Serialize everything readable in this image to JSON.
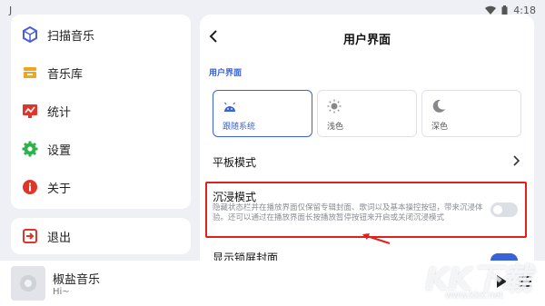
{
  "statusbar": {
    "left_glyph": "J",
    "time": "4:18"
  },
  "sidebar": {
    "items": [
      {
        "label": "扫描音乐",
        "icon": "cube-icon"
      },
      {
        "label": "音乐库",
        "icon": "library-icon"
      },
      {
        "label": "统计",
        "icon": "stats-icon"
      },
      {
        "label": "设置",
        "icon": "gear-icon"
      },
      {
        "label": "关于",
        "icon": "info-icon"
      }
    ],
    "exit": {
      "label": "退出",
      "icon": "exit-icon"
    }
  },
  "player": {
    "title": "椒盐音乐",
    "subtitle": "Hi~"
  },
  "page": {
    "title": "用户界面",
    "section_label": "用户界面",
    "theme_options": [
      {
        "label": "跟随系统",
        "icon": "android-icon",
        "selected": true
      },
      {
        "label": "浅色",
        "icon": "sun-icon",
        "selected": false
      },
      {
        "label": "深色",
        "icon": "moon-icon",
        "selected": false
      }
    ],
    "tablet_mode": "平板模式",
    "immersive": {
      "title": "沉浸模式",
      "description": "隐藏状态栏并在播放界面仅保留专辑封面、歌词以及基本操控按钮，带来沉浸体验。还可以通过在播放界面长按播放暂停按钮来开启或关闭沉浸模式",
      "enabled": false
    },
    "lockscreen_cover": {
      "title": "显示锁屏封面",
      "enabled": true
    }
  },
  "watermark": {
    "logo": "KK下载",
    "url": "www.kkx.net"
  },
  "colors": {
    "accent": "#3a62d8",
    "highlight_red": "#e0201a"
  }
}
